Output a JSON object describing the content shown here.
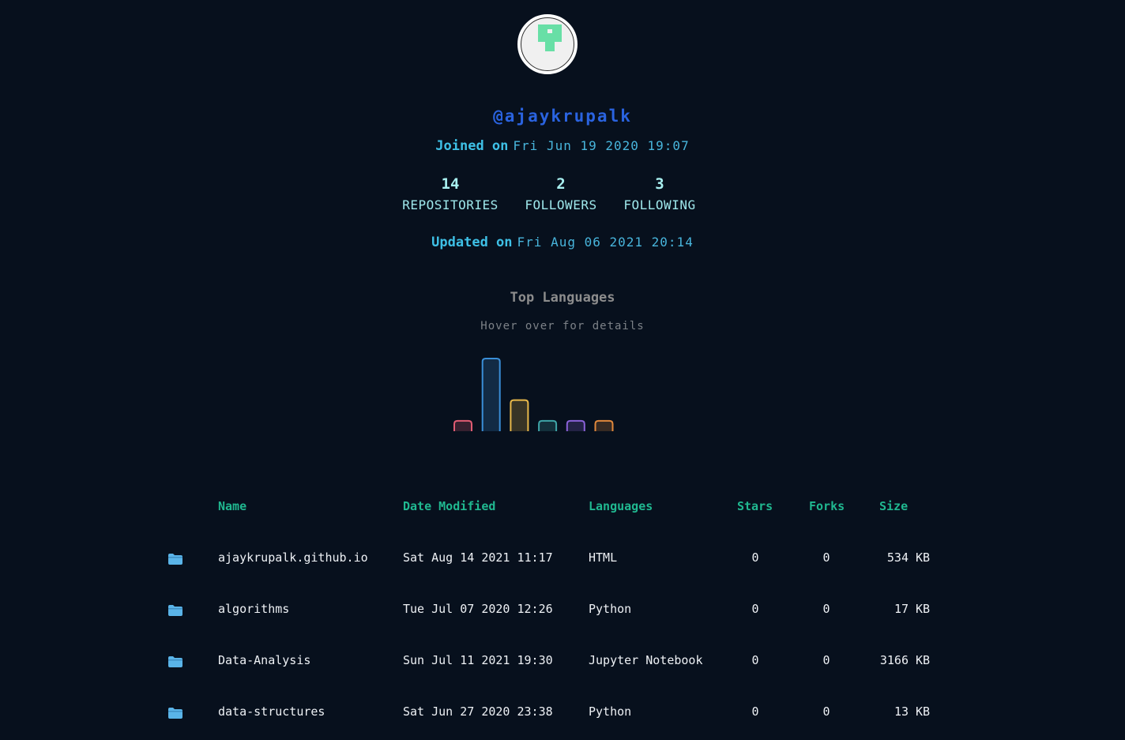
{
  "profile": {
    "username": "@ajaykrupalk",
    "joined_label": "Joined on",
    "joined_date": "Fri Jun 19 2020 19:07",
    "updated_label": "Updated on",
    "updated_date": "Fri Aug 06 2021 20:14"
  },
  "stats": [
    {
      "value": "14",
      "label": "REPOSITORIES"
    },
    {
      "value": "2",
      "label": "FOLLOWERS"
    },
    {
      "value": "3",
      "label": "FOLLOWING"
    }
  ],
  "languages": {
    "title": "Top Languages",
    "subtitle": "Hover over for details"
  },
  "chart_data": {
    "type": "bar",
    "categories": [
      "",
      "",
      "",
      "",
      "",
      ""
    ],
    "values": [
      1,
      7,
      3,
      1,
      1,
      1
    ],
    "colors": [
      "#e05c73",
      "#3a8fd8",
      "#e8b84a",
      "#3fa5a8",
      "#8a62d8",
      "#e0883c"
    ],
    "xlabel": "",
    "ylabel": ""
  },
  "table": {
    "headers": {
      "name": "Name",
      "date": "Date Modified",
      "languages": "Languages",
      "stars": "Stars",
      "forks": "Forks",
      "size": "Size"
    },
    "icon": "folder-icon",
    "rows": [
      {
        "name": "ajaykrupalk.github.io",
        "date": "Sat Aug 14 2021 11:17",
        "language": "HTML",
        "stars": "0",
        "forks": "0",
        "size": "534",
        "unit": "KB"
      },
      {
        "name": "algorithms",
        "date": "Tue Jul 07 2020 12:26",
        "language": "Python",
        "stars": "0",
        "forks": "0",
        "size": "17",
        "unit": "KB"
      },
      {
        "name": "Data-Analysis",
        "date": "Sun Jul 11 2021 19:30",
        "language": "Jupyter Notebook",
        "stars": "0",
        "forks": "0",
        "size": "3166",
        "unit": "KB"
      },
      {
        "name": "data-structures",
        "date": "Sat Jun 27 2020 23:38",
        "language": "Python",
        "stars": "0",
        "forks": "0",
        "size": "13",
        "unit": "KB"
      }
    ]
  },
  "colors": {
    "background": "#07101d",
    "username": "#2a63e0",
    "accent": "#3ec0e6",
    "header": "#20b890",
    "folder": "#5ab4e8"
  }
}
